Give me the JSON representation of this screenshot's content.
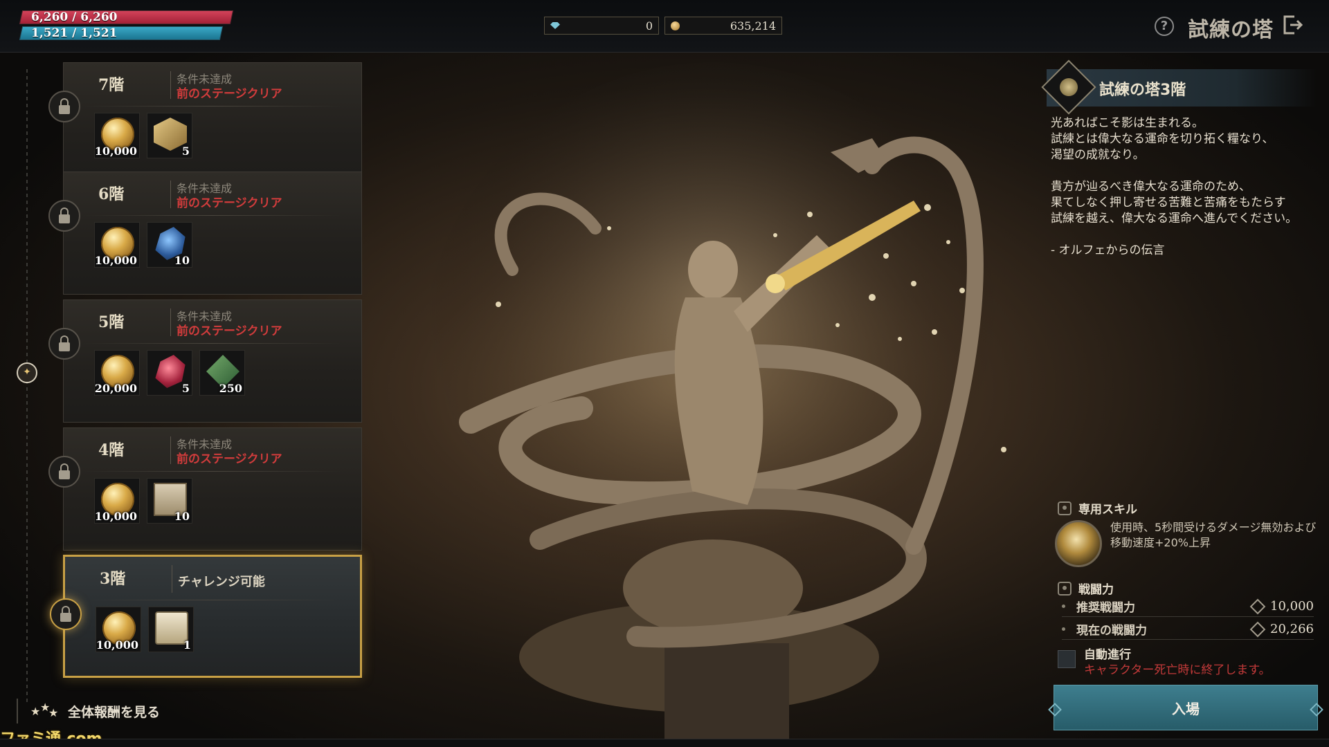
{
  "status": {
    "hp_text": "6,260 / 6,260",
    "hp_fraction": 1.0,
    "mp_text": "1,521 / 1,521",
    "mp_fraction": 1.0
  },
  "currencies": [
    {
      "icon": "gem-icon",
      "value": "0"
    },
    {
      "icon": "gold-coin-icon",
      "value": "635,214"
    }
  ],
  "header": {
    "title": "試練の塔",
    "help_icon": "?"
  },
  "floors": [
    {
      "name": "7階",
      "cond1": "条件未達成",
      "cond2": "前のステージクリア",
      "locked": true,
      "rewards": [
        {
          "icon": "gold-coin",
          "qty": "10,000"
        },
        {
          "icon": "material-box",
          "qty": "5"
        }
      ]
    },
    {
      "name": "6階",
      "cond1": "条件未達成",
      "cond2": "前のステージクリア",
      "locked": true,
      "rewards": [
        {
          "icon": "gold-coin",
          "qty": "10,000"
        },
        {
          "icon": "blue-ore",
          "qty": "10"
        }
      ]
    },
    {
      "name": "5階",
      "cond1": "条件未達成",
      "cond2": "前のステージクリア",
      "locked": true,
      "rewards": [
        {
          "icon": "gold-coin",
          "qty": "20,000"
        },
        {
          "icon": "red-ore",
          "qty": "5"
        },
        {
          "icon": "trophy-badge",
          "qty": "250"
        }
      ]
    },
    {
      "name": "4階",
      "cond1": "条件未達成",
      "cond2": "前のステージクリア",
      "locked": true,
      "rewards": [
        {
          "icon": "gold-coin",
          "qty": "10,000"
        },
        {
          "icon": "document",
          "qty": "10"
        }
      ]
    },
    {
      "name": "3階",
      "status": "チャレンジ可能",
      "locked": false,
      "rewards": [
        {
          "icon": "gold-coin",
          "qty": "10,000"
        },
        {
          "icon": "scroll",
          "qty": "1"
        }
      ]
    }
  ],
  "all_rewards_label": "全体報酬を見る",
  "watermark": "ファミ通.com",
  "detail": {
    "title": "試練の塔3階",
    "lore": [
      "光あればこそ影は生まれる。",
      "試練とは偉大なる運命を切り拓く糧なり、",
      "渇望の成就なり。",
      "",
      "貴方が辿るべき偉大なる運命のため、",
      "果てしなく押し寄せる苦難と苦痛をもたらす",
      "試練を越え、偉大なる運命へ進んでください。",
      "",
      "- オルフェからの伝言"
    ],
    "skill_header": "専用スキル",
    "skill_desc": "使用時、5秒間受けるダメージ無効および\n移動速度+20%上昇",
    "power_header": "戦闘力",
    "recommended_label": "推奨戦闘力",
    "recommended_value": "10,000",
    "current_label": "現在の戦闘力",
    "current_value": "20,266",
    "auto_label": "自動進行",
    "auto_note": "キャラクター死亡時に終了します。",
    "enter_label": "入場"
  },
  "colors": {
    "accent_gold": "#c8a045",
    "warning_red": "#d23c3c",
    "button_teal": "#2f6d7b",
    "hp": "#c4324b",
    "mp": "#2b90ad"
  }
}
